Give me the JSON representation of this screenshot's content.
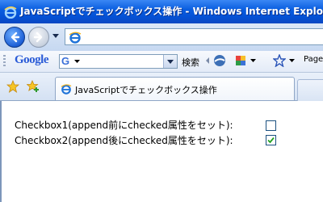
{
  "window": {
    "title": "JavaScriptでチェックボックス操作 - Windows Internet Explorer"
  },
  "toolbar": {
    "google_logo": "Google",
    "search_button": "検索",
    "page_button": "Page"
  },
  "tabs": [
    {
      "label": "JavaScriptでチェックボックス操作"
    }
  ],
  "content": {
    "checkbox1": {
      "label": "Checkbox1(append前にchecked属性をセット):",
      "checked": false
    },
    "checkbox2": {
      "label": "Checkbox2(append後にchecked属性をセット):",
      "checked": true
    }
  },
  "colors": {
    "titlebar": "#0a5ee0",
    "checkmark": "#21a121",
    "checkbox_border": "#1c5180"
  },
  "icons": [
    "ie-logo-icon",
    "back-arrow-icon",
    "forward-arrow-icon",
    "page-icon",
    "favorites-star-icon",
    "add-favorite-icon",
    "feed-icon"
  ]
}
